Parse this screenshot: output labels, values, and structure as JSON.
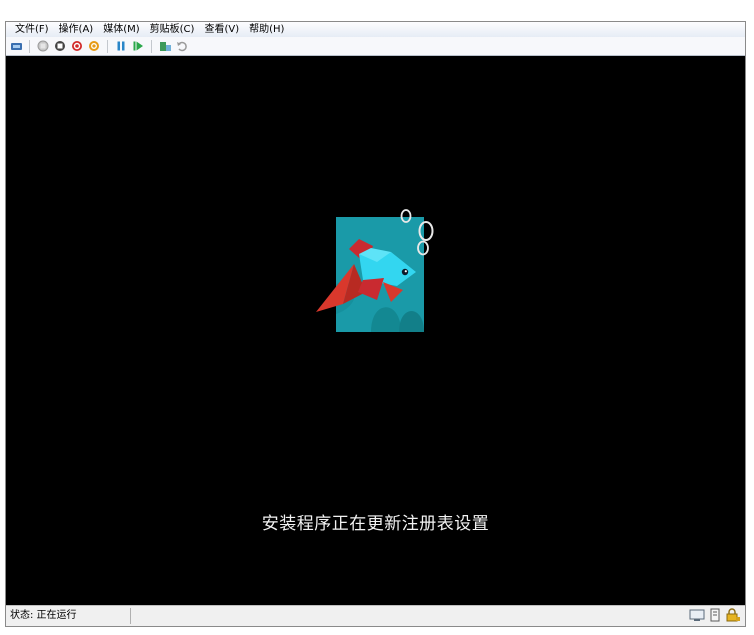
{
  "menu": {
    "items": [
      {
        "label": "文件(F)"
      },
      {
        "label": "操作(A)"
      },
      {
        "label": "媒体(M)"
      },
      {
        "label": "剪贴板(C)"
      },
      {
        "label": "查看(V)"
      },
      {
        "label": "帮助(H)"
      }
    ]
  },
  "toolbar": {
    "icons": [
      "ctrl-alt-del-icon",
      "start-icon",
      "turn-off-icon",
      "shut-down-icon",
      "save-icon",
      "pause-icon",
      "reset-icon",
      "snapshot-icon",
      "revert-icon"
    ]
  },
  "screen": {
    "setup_status": "安装程序正在更新注册表设置",
    "colors": {
      "background": "#000000",
      "tile": "#1a9aa8",
      "fish_body": "#33d6f0",
      "fin_red": "#d9382c"
    }
  },
  "statusbar": {
    "label": "状态: 正在运行",
    "icons": [
      "screen-icon",
      "keyboard-icon",
      "lock-icon"
    ]
  }
}
